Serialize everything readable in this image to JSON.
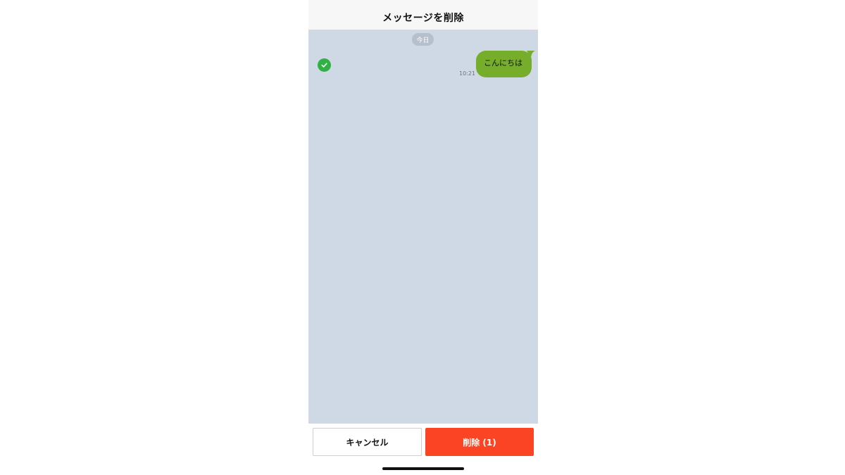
{
  "header": {
    "title": "メッセージを削除"
  },
  "chat": {
    "date_label": "今日",
    "messages": [
      {
        "text": "こんにちは",
        "time": "10:21",
        "selected": true,
        "bubble_color": "#76ad2a"
      }
    ]
  },
  "footer": {
    "cancel_label": "キャンセル",
    "delete_label": "削除 (1)"
  },
  "colors": {
    "chat_background": "#cfd9e5",
    "check_green": "#2fb144",
    "delete_red": "#fa4423"
  },
  "icons": {
    "selection": "check-circle-icon"
  }
}
